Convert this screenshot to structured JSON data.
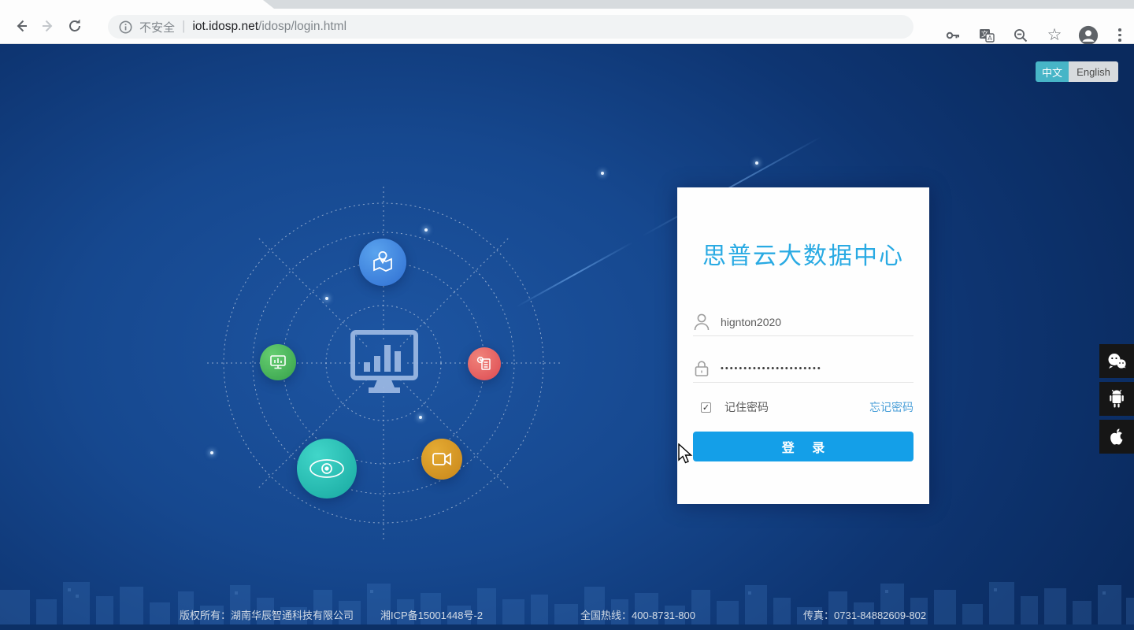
{
  "browser": {
    "not_secure_label": "不安全",
    "divider": "|",
    "host": "iot.idosp.net",
    "path": "/idosp/login.html"
  },
  "language_toggle": {
    "chinese_label": "中文",
    "english_label": "English"
  },
  "login_card": {
    "title": "思普云大数据中心",
    "username_value": "hignton2020",
    "password_masked_value": "••••••••••••••••••••••",
    "remember_label": "记住密码",
    "forgot_password_label": "忘记密码",
    "login_button_label": "登 录"
  },
  "diagram": {
    "center_icon": "dashboard-monitor-icon",
    "satellite_icons": [
      "map-location-icon",
      "display-icon",
      "report-icon",
      "eye-monitoring-icon",
      "video-camera-icon"
    ]
  },
  "side_dock": {
    "icons": [
      "wechat-icon",
      "android-icon",
      "apple-icon"
    ]
  },
  "colors": {
    "accent_cyan": "#47b5c7",
    "title_blue": "#29aae3",
    "button_blue": "#149fe8",
    "link_blue": "#4a9fd8",
    "page_bg_deep": "#0a2a5e",
    "page_bg_glow": "#1d55a2"
  },
  "footer": {
    "copyright": "版权所有：湖南华辰智通科技有限公司",
    "icp": "湘ICP备15001448号-2",
    "hotline": "全国热线：400-8731-800",
    "fax": "传真：0731-84882609-802"
  }
}
